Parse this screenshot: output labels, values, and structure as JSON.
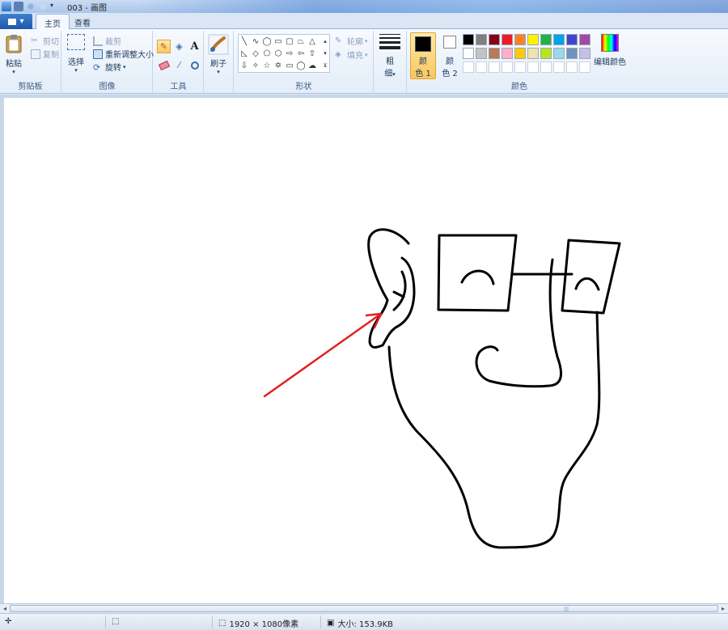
{
  "window": {
    "title": "003 - 画图"
  },
  "tabs": [
    {
      "label": "主页"
    },
    {
      "label": "查看"
    }
  ],
  "clipboard": {
    "paste": "粘贴",
    "cut": "剪切",
    "copy": "复制",
    "label": "剪贴板"
  },
  "image": {
    "select": "选择",
    "crop": "裁剪",
    "resize": "重新调整大小",
    "rotate": "旋转",
    "label": "图像"
  },
  "tools": {
    "label": "工具",
    "text_glyph": "A"
  },
  "brushes": {
    "label": "刷子"
  },
  "shapes": {
    "outline": "轮廓",
    "fill": "填充",
    "label": "形状"
  },
  "size": {
    "label_top": "粗",
    "label_bottom": "细"
  },
  "colors": {
    "color1_top": "颜",
    "color1_bottom": "色 1",
    "color2_top": "颜",
    "color2_bottom": "色 2",
    "edit": "编辑颜色",
    "label": "颜色",
    "color1_value": "#000000",
    "color2_value": "#ffffff",
    "palette_row1": [
      "#000000",
      "#7f7f7f",
      "#880015",
      "#ed1c24",
      "#ff7f27",
      "#fff200",
      "#22b14c",
      "#00a2e8",
      "#3f48cc",
      "#a349a4"
    ],
    "palette_row2": [
      "#ffffff",
      "#c3c3c3",
      "#b97a57",
      "#ffaec9",
      "#ffc90e",
      "#efe4b0",
      "#b5e61d",
      "#99d9ea",
      "#7092be",
      "#c8bfe7"
    ],
    "palette_row3": [
      "#ffffff",
      "#ffffff",
      "#ffffff",
      "#ffffff",
      "#ffffff",
      "#ffffff",
      "#ffffff",
      "#ffffff",
      "#ffffff",
      "#ffffff"
    ]
  },
  "status": {
    "dimensions": "1920 × 1080像素",
    "filesize": "大小: 153.9KB"
  },
  "drawing": {
    "stroke_color": "#000000",
    "arrow_color": "#e02020"
  }
}
